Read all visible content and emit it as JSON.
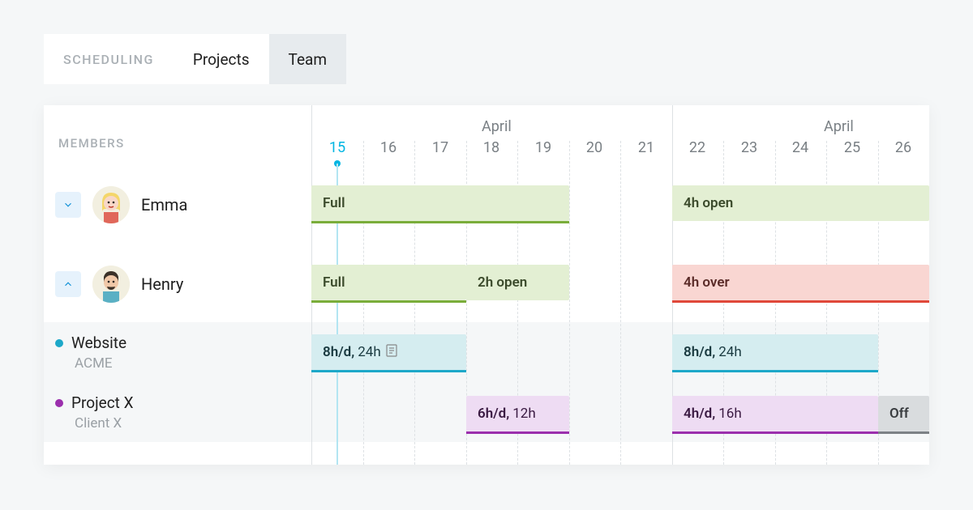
{
  "tabs": {
    "label": "SCHEDULING",
    "items": [
      "Projects",
      "Team"
    ],
    "active": 1
  },
  "sidebar": {
    "header": "MEMBERS",
    "members": [
      {
        "name": "Emma",
        "expanded": false
      },
      {
        "name": "Henry",
        "expanded": true
      }
    ],
    "projects": [
      {
        "name": "Website",
        "client": "ACME",
        "color": "#1da8c9"
      },
      {
        "name": "Project X",
        "client": "Client X",
        "color": "#9b2fad"
      }
    ]
  },
  "timeline": {
    "month": "April",
    "days": [
      "15",
      "16",
      "17",
      "18",
      "19",
      "20",
      "21",
      "22",
      "23",
      "24",
      "25",
      "26"
    ],
    "today_index": 0
  },
  "bars": {
    "emma_full": "Full",
    "emma_open": "4h open",
    "henry_full": "Full",
    "henry_open": "2h open",
    "henry_over": "4h over",
    "website_a_bold": "8h/d,",
    "website_a_rest": "24h",
    "website_b_bold": "8h/d,",
    "website_b_rest": "24h",
    "projx_a_bold": "6h/d,",
    "projx_a_rest": "12h",
    "projx_b_bold": "4h/d,",
    "projx_b_rest": "16h",
    "off": "Off"
  }
}
